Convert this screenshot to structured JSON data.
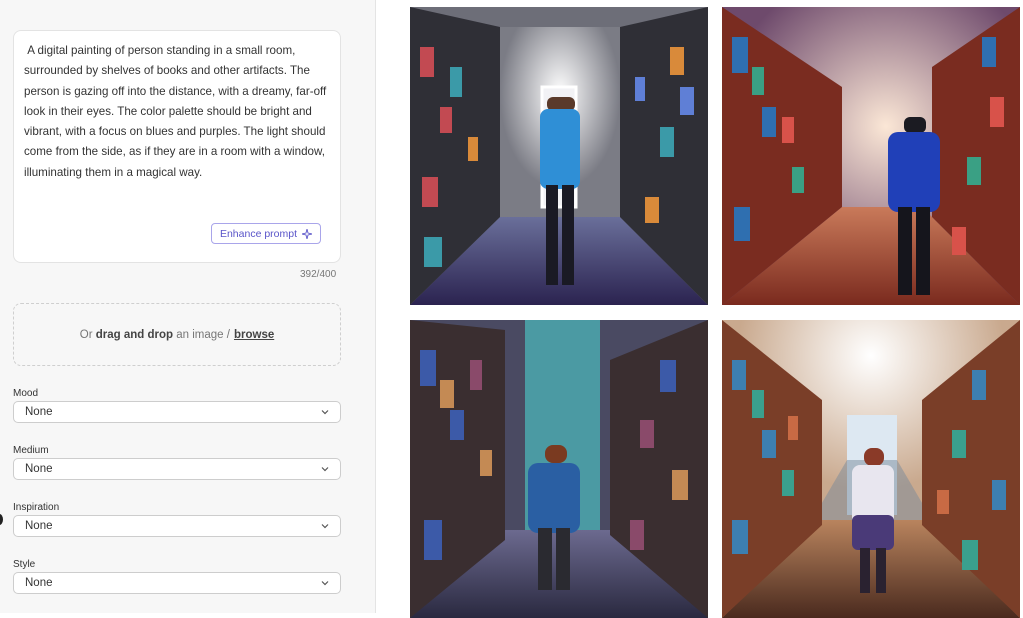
{
  "prompt": {
    "text": " A digital painting of person standing in a small room,\nsurrounded by shelves of books and other artifacts. The\nperson is gazing off into the distance, with a dreamy, far-off\nlook in their eyes. The color palette should be bright and\nvibrant, with a focus on blues and purples. The light should\ncome from the side, as if they are in a room with a window,\nilluminating them in a magical way.",
    "enhance_label": "Enhance prompt",
    "char_count": "392/400"
  },
  "upload": {
    "prefix": "Or",
    "drag_drop": "drag and drop",
    "middle": "an image /",
    "browse": "browse"
  },
  "fields": [
    {
      "label": "Mood",
      "value": "None"
    },
    {
      "label": "Medium",
      "value": "None"
    },
    {
      "label": "Inspiration",
      "value": "None"
    },
    {
      "label": "Style",
      "value": "None"
    }
  ],
  "colors": {
    "accent": "#5a55c9",
    "sidebar_bg": "#f7f7f7"
  }
}
